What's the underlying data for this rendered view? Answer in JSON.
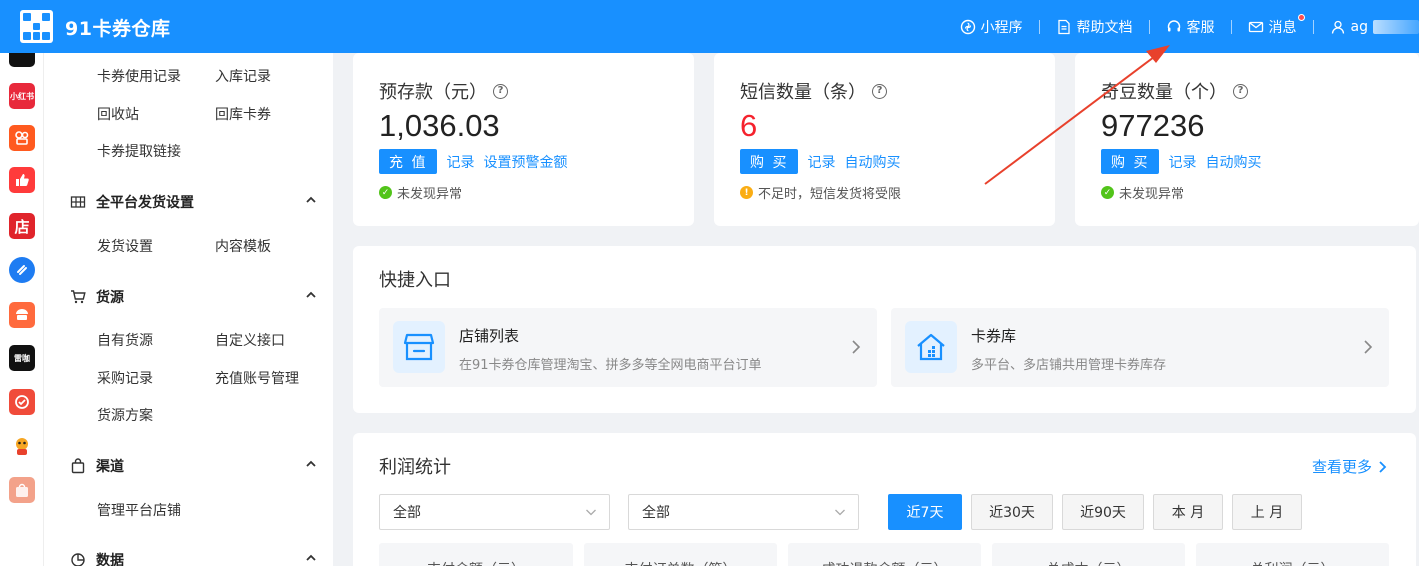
{
  "header": {
    "brand": "91卡券仓库",
    "links": [
      {
        "label": "小程序",
        "icon": "mini-program-icon"
      },
      {
        "label": "帮助文档",
        "icon": "document-icon"
      },
      {
        "label": "客服",
        "icon": "headset-icon"
      },
      {
        "label": "消息",
        "icon": "mail-icon"
      },
      {
        "label": "ag",
        "icon": "user-icon"
      }
    ]
  },
  "rail": {
    "items": [
      {
        "icon": "tiktok-icon",
        "color": "#111111",
        "text": ""
      },
      {
        "icon": "xiaohongshu-icon",
        "color": "#e8293b",
        "text": "小红书"
      },
      {
        "icon": "kuaishou-icon",
        "color": "#ff5a1f",
        "text": ""
      },
      {
        "icon": "thumbs-up-icon",
        "color": "#ff3b3b",
        "text": ""
      },
      {
        "icon": "store-icon",
        "color": "#e0242b",
        "text": "店"
      },
      {
        "icon": "link-app-icon",
        "color": "#1e7cf2",
        "text": ""
      },
      {
        "icon": "meituan-icon",
        "color": "#ff6a3d",
        "text": ""
      },
      {
        "icon": "shandian-icon",
        "color": "#111111",
        "text": "雷咖"
      },
      {
        "icon": "shield-app-icon",
        "color": "#f04b3a",
        "text": ""
      },
      {
        "icon": "mascot-icon",
        "color": "#f6a623",
        "text": ""
      },
      {
        "icon": "shopee-icon",
        "color": "#f3a28a",
        "text": ""
      }
    ]
  },
  "menu": {
    "top_items": [
      "卡券使用记录",
      "入库记录",
      "回收站",
      "回库卡券",
      "卡券提取链接"
    ],
    "groups": [
      {
        "title": "全平台发货设置",
        "icon": "grid-icon",
        "items": [
          "发货设置",
          "内容模板"
        ]
      },
      {
        "title": "货源",
        "icon": "cart-icon",
        "items": [
          "自有货源",
          "自定义接口",
          "采购记录",
          "充值账号管理",
          "货源方案"
        ]
      },
      {
        "title": "渠道",
        "icon": "bag-icon",
        "items": [
          "管理平台店铺"
        ]
      },
      {
        "title": "数据",
        "icon": "pie-chart-icon",
        "items": []
      }
    ]
  },
  "stats": [
    {
      "title": "预存款（元）",
      "value": "1,036.03",
      "value_color": "#222222",
      "primary": "充 值",
      "links": [
        "记录",
        "设置预警金额"
      ],
      "status": "未发现异常",
      "status_type": "ok"
    },
    {
      "title": "短信数量（条）",
      "value": "6",
      "value_color": "#f5222d",
      "primary": "购 买",
      "links": [
        "记录",
        "自动购买"
      ],
      "status": "不足时，短信发货将受限",
      "status_type": "warn"
    },
    {
      "title": "奇豆数量（个）",
      "value": "977236",
      "value_color": "#222222",
      "primary": "购 买",
      "links": [
        "记录",
        "自动购买"
      ],
      "status": "未发现异常",
      "status_type": "ok"
    }
  ],
  "quick": {
    "title": "快捷入口",
    "items": [
      {
        "name": "店铺列表",
        "desc": "在91卡券仓库管理淘宝、拼多多等全网电商平台订单",
        "icon": "shop-icon"
      },
      {
        "name": "卡券库",
        "desc": "多平台、多店铺共用管理卡券库存",
        "icon": "warehouse-icon"
      }
    ]
  },
  "profit": {
    "title": "利润统计",
    "more": "查看更多",
    "selects": [
      "全部",
      "全部"
    ],
    "periods": [
      "近7天",
      "近30天",
      "近90天",
      "本 月",
      "上 月"
    ],
    "active_period": "近7天",
    "metric_cards": [
      "支付金额（元）",
      "支付订单数（笔）",
      "成功退款金额（元）",
      "总成本（元）",
      "总利润（元）"
    ]
  },
  "colors": {
    "primary": "#1890ff",
    "danger": "#f5222d",
    "success": "#52c41a",
    "warning": "#faad14",
    "annotation": "#e8412c"
  }
}
